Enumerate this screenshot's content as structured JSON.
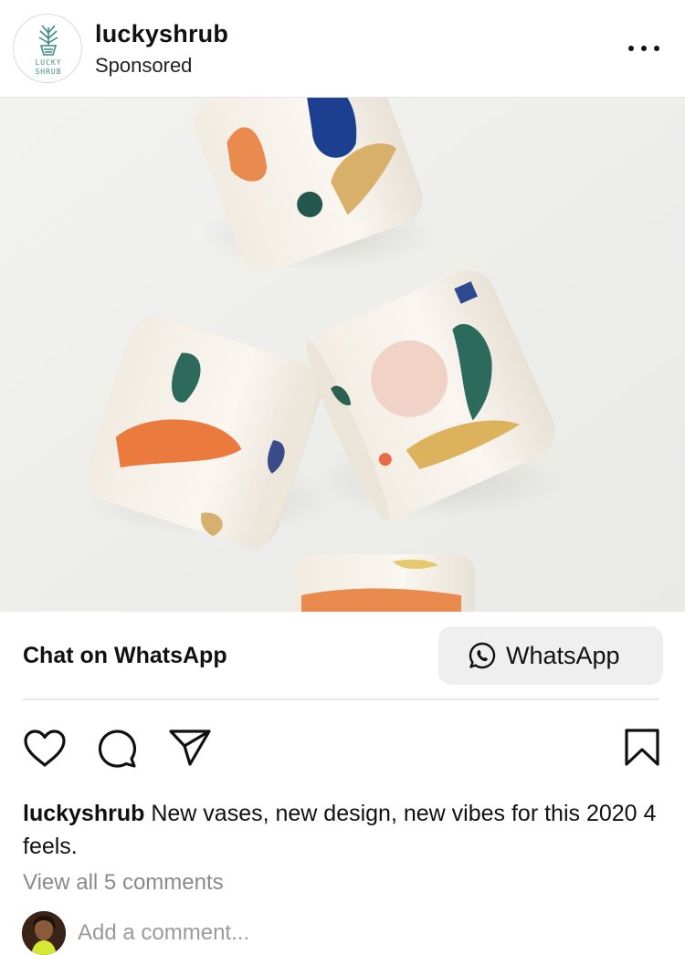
{
  "post": {
    "username": "luckyshrub",
    "sponsored_label": "Sponsored",
    "avatar_text_line1": "LUCKY",
    "avatar_text_line2": "SHRUB",
    "brand_color": "#3c8c86"
  },
  "media": {
    "subject": "painted ceramic cups"
  },
  "cta": {
    "text": "Chat on WhatsApp",
    "button_label": "WhatsApp",
    "button_icon": "whatsapp-icon"
  },
  "actions": {
    "like_icon": "heart-icon",
    "comment_icon": "comment-icon",
    "share_icon": "send-icon",
    "save_icon": "bookmark-icon"
  },
  "caption": {
    "username": "luckyshrub",
    "text": "New vases, new design, new vibes for this 2020 4 feels."
  },
  "comments": {
    "view_all": "View all 5 comments",
    "add_placeholder": "Add a comment..."
  }
}
